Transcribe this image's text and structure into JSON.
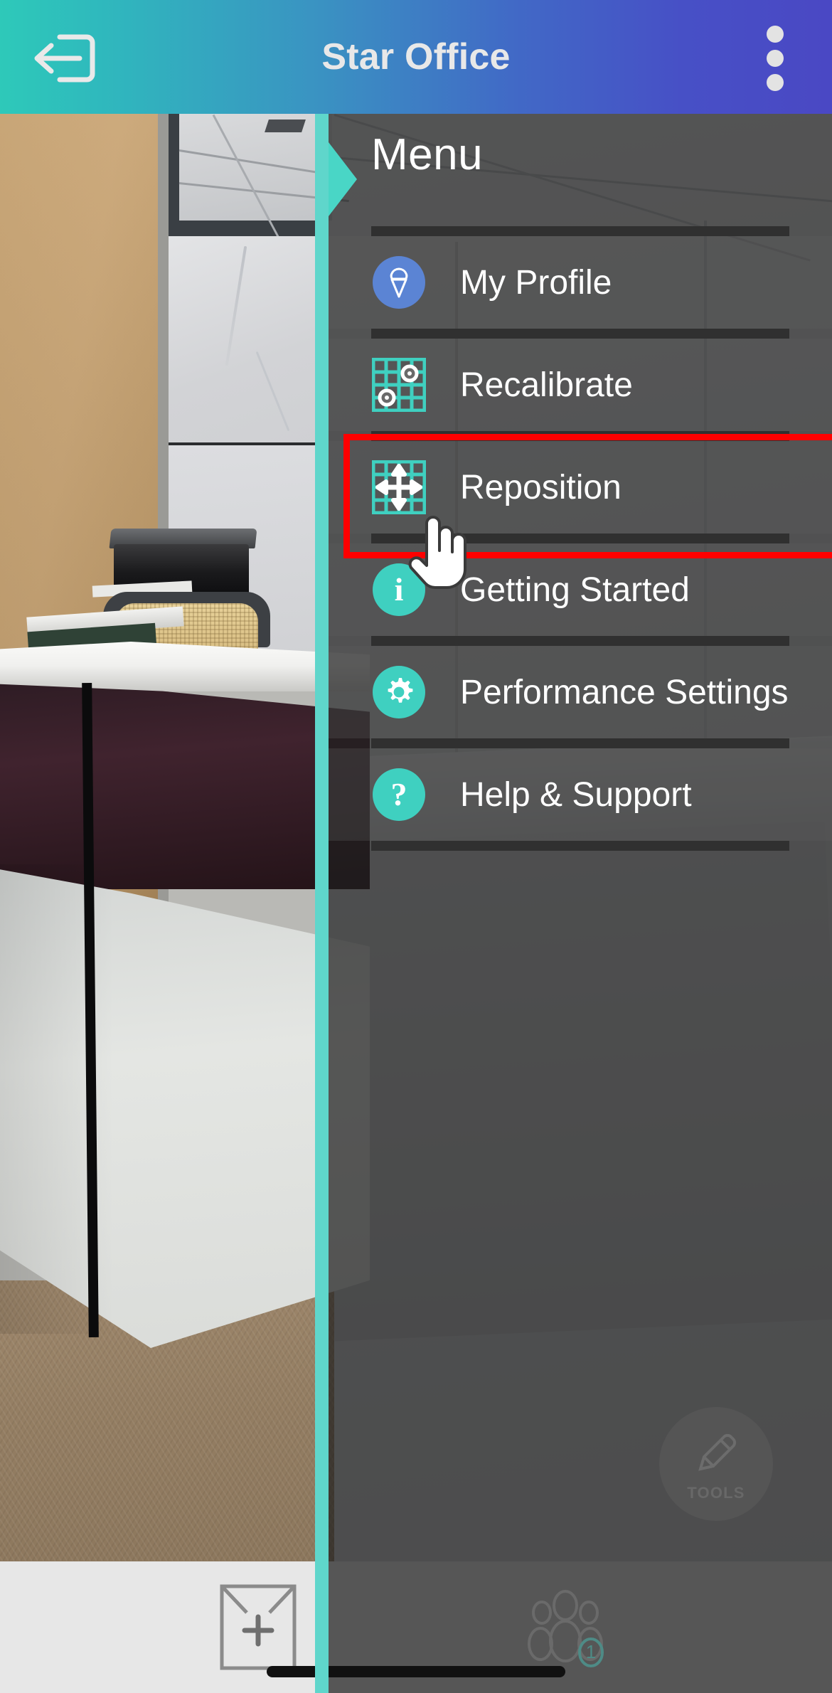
{
  "app": {
    "title": "Star Office",
    "topbar": {
      "exit_icon": "exit-icon",
      "overflow_icon": "more-vertical-icon",
      "gradient_start": "#2ec9b9",
      "gradient_end": "#4a48c4"
    }
  },
  "drawer": {
    "title": "Menu",
    "accent_color": "#3fd0c0",
    "handle_icon": "drawer-handle-arrow-icon",
    "items": [
      {
        "label": "My Profile",
        "icon": "ice-cream-cone-avatar-icon",
        "icon_color": "#5b84d4",
        "glyph": "☙"
      },
      {
        "label": "Recalibrate",
        "icon": "grid-calibrate-icon",
        "icon_color": "#3fd0c0",
        "glyph": ""
      },
      {
        "label": "Reposition",
        "icon": "grid-move-icon",
        "icon_color": "#3fd0c0",
        "glyph": "",
        "highlighted": true
      },
      {
        "label": "Getting Started",
        "icon": "info-icon",
        "icon_color": "#3fd0c0",
        "glyph": "i"
      },
      {
        "label": "Performance Settings",
        "icon": "gear-icon",
        "icon_color": "#3fd0c0",
        "glyph": ""
      },
      {
        "label": "Help & Support",
        "icon": "question-mark-icon",
        "icon_color": "#3fd0c0",
        "glyph": "?"
      }
    ]
  },
  "highlight": {
    "color": "#ff0000",
    "target_label": "Reposition"
  },
  "cursor": {
    "icon": "hand-pointer-cursor-icon",
    "over": "Reposition"
  },
  "tools_button": {
    "label": "TOOLS",
    "icon": "pencil-icon"
  },
  "bottom_bar": {
    "add_room_icon": "add-room-icon",
    "people_icon": "people-group-icon",
    "people_badge": "1",
    "home_indicator": "home-indicator"
  }
}
